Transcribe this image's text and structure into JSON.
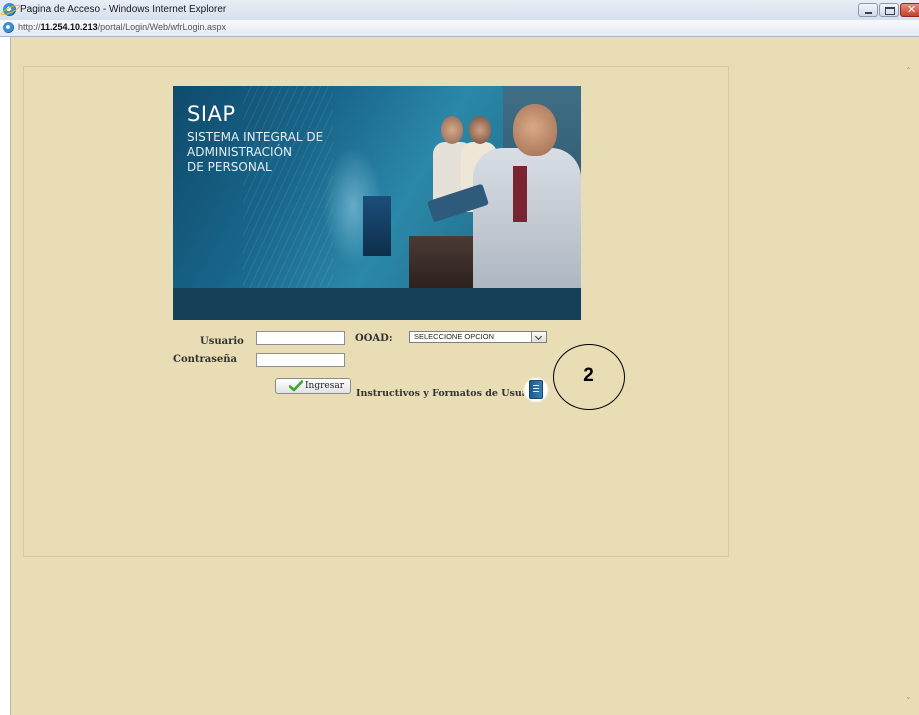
{
  "window": {
    "title": "Pagina de Acceso - Windows Internet Explorer",
    "url_prefix": "http://",
    "url_host": "11.254.10.213",
    "url_path": "/portal/Login/Web/wfrLogin.aspx"
  },
  "banner": {
    "title": "SIAP",
    "subtitle_lines": [
      "SISTEMA INTEGRAL DE",
      "ADMINISTRACIÓN",
      "DE PERSONAL"
    ]
  },
  "login": {
    "user_label": "Usuario",
    "user_value": "",
    "password_label": "Contraseña",
    "password_value": "",
    "ooad_label": "OOAD:",
    "ooad_selected": "SELECCIONE OPCION",
    "submit_label": "Ingresar",
    "instructivos_label": "Instructivos y Formatos de Usuarios"
  },
  "annotation": {
    "number": "2"
  },
  "colors": {
    "page_background": "#e8ddb5",
    "banner_blue": "#18658a",
    "banner_footer": "#163f58",
    "check_green": "#3aa62b"
  },
  "icons": {
    "browser": "ie-logo-icon",
    "submit": "green-check-icon",
    "instructivos": "book-icon"
  }
}
